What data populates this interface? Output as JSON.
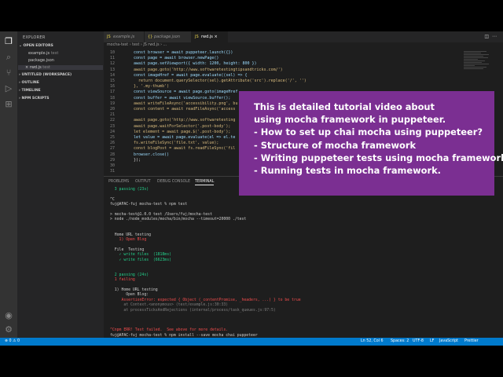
{
  "sidebar": {
    "title": "EXPLORER",
    "open_editors": "OPEN EDITORS",
    "files": [
      {
        "name": "example.js",
        "hint": "test"
      },
      {
        "name": "package.json",
        "hint": ""
      },
      {
        "name": "rwd.js",
        "hint": "test"
      }
    ],
    "sections": [
      "UNTITLED (WORKSPACE)",
      "OUTLINE",
      "TIMELINE",
      "NPM SCRIPTS"
    ]
  },
  "tabs": [
    {
      "label": "example.js"
    },
    {
      "label": "package.json"
    },
    {
      "label": "rwd.js"
    }
  ],
  "breadcrumb": "mocha-test › test › JS rwd.js › ...",
  "editor": {
    "line_numbers": [
      "10",
      "11",
      "12",
      "13",
      "14",
      "15",
      "16",
      "17",
      "18",
      "19",
      "20",
      "21",
      "22",
      "23",
      "24",
      "25",
      "26",
      "27",
      "28",
      "29",
      "30",
      "31"
    ],
    "lines": [
      "const browser = await puppeteer.launch({})",
      "const page = await browser.newPage()",
      "await page.setViewport({ width: 1200, height: 800 })",
      "await page.goto('http://www.softwaretestingtipsandtricks.com/')",
      "const imageHref = await page.evaluate((sel) => {",
      "  return document.querySelector(sel).getAttribute('src').replace('/', '')",
      "}, '.my-thumb')",
      "const viewSource = await page.goto(imageHref",
      "const buffer = await viewSource.buffer();",
      "await writeFileAsync('accessibility.png', bu",
      "const content = await readFileAsync('access",
      "",
      "await page.goto('http://www.softwaretesting",
      "await page.waitForSelector('.post-body');",
      "let element = await page.$('.post-body');",
      "let value = await page.evaluate(el => el.te",
      "fs.writeFileSync('file.txt', value);",
      "const blogPost = await fs.readFileSync('fil",
      "browser.close()",
      "});",
      "",
      ""
    ]
  },
  "overlay": {
    "lines": [
      "This is detailed tutorial video about",
      "using mocha framework in puppeteer.",
      "- How to set up chai mocha using puppeteer?",
      "- Structure of mocha framework",
      "- Writing puppeteer tests using mocha framework",
      "- Running tests in mocha framework."
    ]
  },
  "panel": {
    "tabs": [
      "PROBLEMS",
      "OUTPUT",
      "DEBUG CONSOLE",
      "TERMINAL"
    ],
    "terminal": [
      "  3 passing (23s)",
      "",
      "^C",
      "fuj@APAC-fuj mocha-test % npm test",
      "",
      "> mocha-test@1.0.0 test /Users/fuj/mocha-test",
      "> node ./node_modules/mocha/bin/mocha --timeout=20000 ./test",
      "",
      "",
      "  Home URL testing",
      "    1) Open Blog",
      "",
      "  File  Testing",
      "    ✓ write files  (1818ms)",
      "    ✓ write files  (6623ms)",
      "",
      "",
      "  2 passing (24s)",
      "  1 failing",
      "",
      "  1) Home URL testing",
      "       Open Blog:",
      "     AssertionError: expected { Object (_contentPromise, _headers, ...) } to be true",
      "      at Context.<anonymous> (test/example.js:30:33)",
      "      at processTicksAndRejections (internal/process/task_queues.js:97:5)",
      "",
      "",
      "",
      "^Cnpm ERR! Test failed.  See above for more details.",
      "fuj@APAC-fuj mocha-test % npm install --save mocha chai puppeteer"
    ]
  },
  "status": {
    "left": "⊗ 0 ⚠ 0",
    "position": "Ln 52, Col 6",
    "spaces": "Spaces: 2",
    "encoding": "UTF-8",
    "eol": "LF",
    "language": "JavaScript",
    "formatter": "Prettier"
  }
}
